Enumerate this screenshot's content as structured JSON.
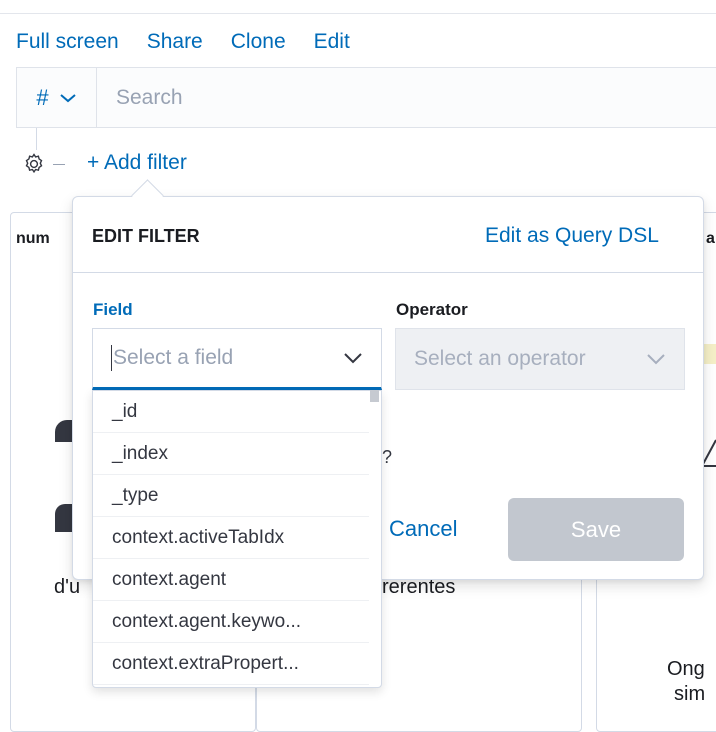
{
  "nav": {
    "full_screen": "Full screen",
    "share": "Share",
    "clone": "Clone",
    "edit": "Edit"
  },
  "query": {
    "language_label": "#",
    "search_placeholder": "Search"
  },
  "filter_bar": {
    "add_filter": "+ Add filter"
  },
  "background": {
    "panel1_title": "num",
    "panel1_text": "d'u",
    "panel2_text": "rerentes",
    "panel3_title": "al",
    "panel3_line1": "Ong",
    "panel3_line2": "sim"
  },
  "edit_filter": {
    "title": "EDIT FILTER",
    "edit_as_dsl": "Edit as Query DSL",
    "field_label": "Field",
    "operator_label": "Operator",
    "field_placeholder": "Select a field",
    "operator_placeholder": "Select an operator",
    "hidden_text_fragment": "?",
    "cancel": "Cancel",
    "save": "Save",
    "field_options": [
      "_id",
      "_index",
      "_type",
      "context.activeTabIdx",
      "context.agent",
      "context.agent.keywo...",
      "context.extraPropert..."
    ]
  },
  "colors": {
    "link": "#006bb8",
    "text": "#343741",
    "border": "#d3dae6",
    "disabled_button": "#c2c7cf"
  }
}
